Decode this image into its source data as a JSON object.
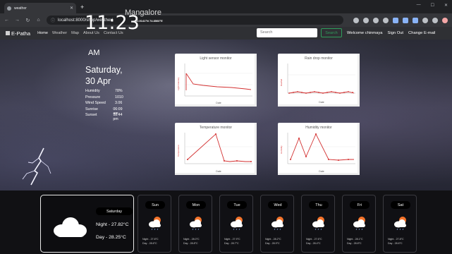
{
  "browser": {
    "tab_title": "weather",
    "url": "localhost:8000/shop/weather/"
  },
  "site": {
    "brand": "E-Patha",
    "nav": [
      "Home",
      "Weather",
      "Map",
      "About Us",
      "Contact Us"
    ],
    "search_placeholder": "Search",
    "search_button": "Search",
    "welcome": "Welcome chinmaya",
    "sign_out": "Sign Out",
    "change_email": "Change E-mail"
  },
  "current": {
    "time": "11:23",
    "ampm": "AM",
    "city": "Mangalore",
    "coords": "12.9141°N 74.8560°E",
    "day": "Saturday,",
    "date": "30 Apr",
    "stats": [
      {
        "label": "Humidity",
        "value": "78%"
      },
      {
        "label": "Pressure",
        "value": "1010"
      },
      {
        "label": "Wind Speed",
        "value": "3.06"
      },
      {
        "label": "Sunrise",
        "value": "06:09 am"
      },
      {
        "label": "Sunset",
        "value": "18:44 pm"
      }
    ]
  },
  "monitors": {
    "light": {
      "title": "Light sensor monitor",
      "ylabel": "Light Intensity",
      "xlabel": "Date"
    },
    "rain": {
      "title": "Rain drop monitor",
      "ylabel": "Rainfall",
      "xlabel": "Date"
    },
    "temp": {
      "title": "Temperature monitor",
      "ylabel": "Temperature",
      "xlabel": "Date"
    },
    "humidity": {
      "title": "Humidity monitor",
      "ylabel": "Humidity",
      "xlabel": "Date"
    }
  },
  "today": {
    "day": "Saturday",
    "night": "Night - 27.82°C",
    "day_temp": "Day - 28.25°C"
  },
  "forecast": [
    {
      "day": "Sun",
      "night": "Night - 27.8°C",
      "daytemp": "Day - 28.6°C"
    },
    {
      "day": "Mon",
      "night": "Night - 28.0°C",
      "daytemp": "Day - 28.8°C"
    },
    {
      "day": "Tue",
      "night": "Night - 27.9°C",
      "daytemp": "Day - 28.7°C"
    },
    {
      "day": "Wed",
      "night": "Night - 28.2°C",
      "daytemp": "Day - 28.9°C"
    },
    {
      "day": "Thu",
      "night": "Night - 27.6°C",
      "daytemp": "Day - 28.4°C"
    },
    {
      "day": "Fri",
      "night": "Night - 28.1°C",
      "daytemp": "Day - 28.8°C"
    },
    {
      "day": "Sat",
      "night": "Night - 27.8°C",
      "daytemp": "Day - 28.6°C"
    }
  ]
}
